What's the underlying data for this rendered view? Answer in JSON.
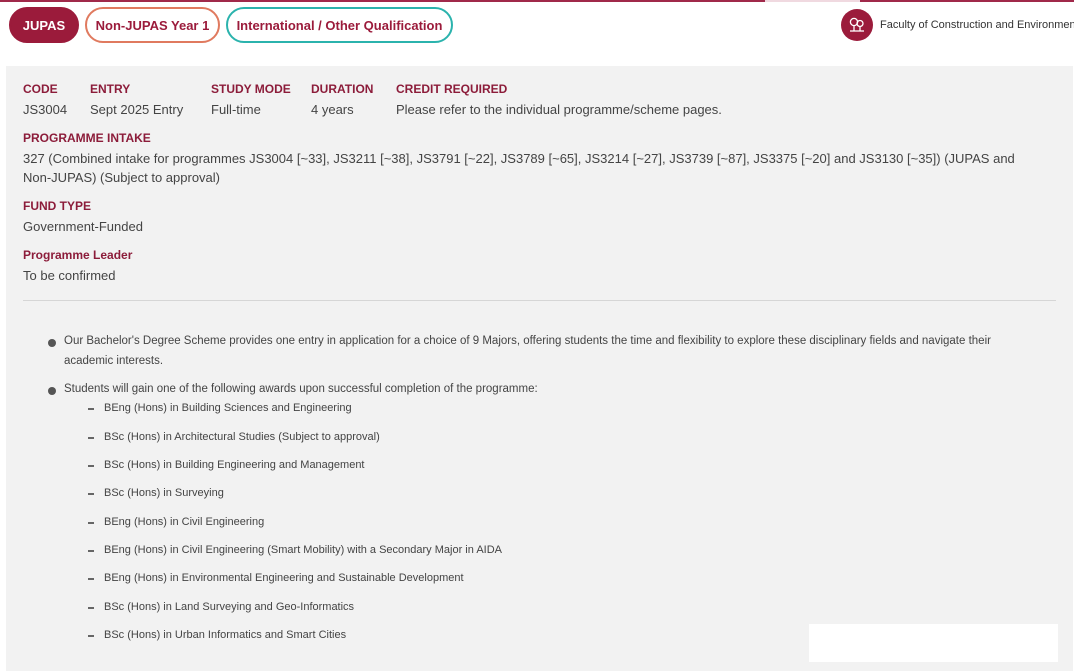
{
  "tabs": [
    {
      "label": "JUPAS"
    },
    {
      "label": "Non-JUPAS Year 1"
    },
    {
      "label": "International / Other Qualification"
    }
  ],
  "faculty": {
    "label": "Faculty of Construction and Environment",
    "icon": "trees-icon"
  },
  "info": {
    "code_label": "CODE",
    "code": "JS3004",
    "entry_label": "ENTRY",
    "entry": "Sept 2025 Entry",
    "mode_label": "STUDY MODE",
    "mode": "Full-time",
    "duration_label": "DURATION",
    "duration": "4 years",
    "credit_label": "CREDIT REQUIRED",
    "credit": "Please refer to the individual programme/scheme pages.",
    "intake_label": "PROGRAMME INTAKE",
    "intake_line1": "327 (Combined intake for programmes JS3004 [~33], JS3211 [~38], JS3791 [~22], JS3789 [~65], JS3214 [~27], JS3739 [~87], JS3375 [~20] and JS3130 [~35]) (JUPAS and",
    "intake_line2": "Non-JUPAS) (Subject to approval)",
    "fund_label": "FUND TYPE",
    "fund": "Government-Funded",
    "leader_label": "Programme Leader",
    "leader": "To be confirmed"
  },
  "bullets": {
    "b1_line1": "Our Bachelor's Degree Scheme provides one entry in application for a choice of 9 Majors, offering students the time and flexibility to explore these disciplinary fields and navigate their",
    "b1_line2": "academic interests.",
    "b2": "Students will gain one of the following awards upon successful completion of the programme:"
  },
  "awards": [
    "BEng (Hons) in Building Sciences and Engineering",
    "BSc (Hons) in Architectural Studies (Subject to approval)",
    "BSc (Hons) in Building Engineering and Management",
    "BSc (Hons) in Surveying",
    "BEng (Hons) in Civil Engineering",
    "BEng (Hons) in Civil Engineering (Smart Mobility) with a Secondary Major in AIDA",
    "BEng (Hons) in Environmental Engineering and Sustainable Development",
    "BSc (Hons) in Land Surveying and Geo-Informatics",
    "BSc (Hons) in Urban Informatics and Smart Cities"
  ]
}
